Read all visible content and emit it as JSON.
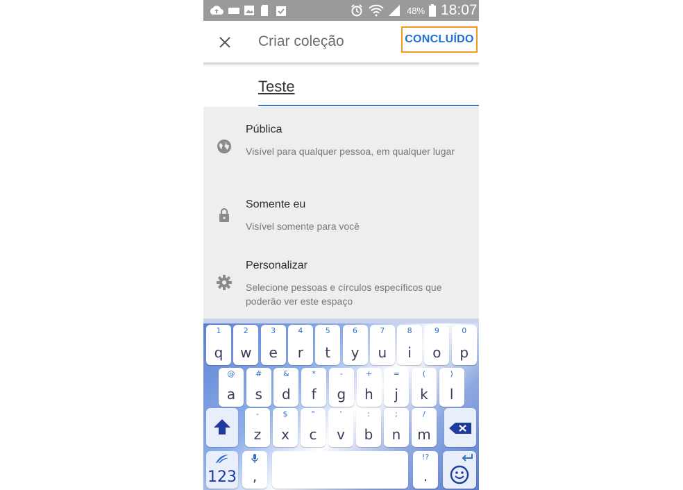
{
  "status_bar": {
    "battery": "48%",
    "time": "18:07"
  },
  "header": {
    "title": "Criar coleção",
    "done_label": "CONCLUÍDO"
  },
  "name_field": {
    "value": "Teste"
  },
  "options": [
    {
      "title": "Pública",
      "description": "Visível para qualquer pessoa, em qualquer lugar",
      "icon": "globe-icon"
    },
    {
      "title": "Somente eu",
      "description": "Visível somente para você",
      "icon": "lock-icon"
    },
    {
      "title": "Personalizar",
      "description": "Selecione pessoas e círculos específicos que poderão ver este espaço",
      "icon": "gear-icon"
    }
  ],
  "keyboard": {
    "row1": [
      {
        "k": "q",
        "s": "1"
      },
      {
        "k": "w",
        "s": "2"
      },
      {
        "k": "e",
        "s": "3"
      },
      {
        "k": "r",
        "s": "4"
      },
      {
        "k": "t",
        "s": "5"
      },
      {
        "k": "y",
        "s": "6"
      },
      {
        "k": "u",
        "s": "7"
      },
      {
        "k": "i",
        "s": "8"
      },
      {
        "k": "o",
        "s": "9"
      },
      {
        "k": "p",
        "s": "0"
      }
    ],
    "row2": [
      {
        "k": "a",
        "s": "@"
      },
      {
        "k": "s",
        "s": "#"
      },
      {
        "k": "d",
        "s": "&"
      },
      {
        "k": "f",
        "s": "*"
      },
      {
        "k": "g",
        "s": "-"
      },
      {
        "k": "h",
        "s": "+"
      },
      {
        "k": "j",
        "s": "="
      },
      {
        "k": "k",
        "s": "("
      },
      {
        "k": "l",
        "s": ")"
      }
    ],
    "row3": [
      {
        "k": "z",
        "s": "-"
      },
      {
        "k": "x",
        "s": "$"
      },
      {
        "k": "c",
        "s": "\""
      },
      {
        "k": "v",
        "s": "'"
      },
      {
        "k": "b",
        "s": ":"
      },
      {
        "k": "n",
        "s": ";"
      },
      {
        "k": "m",
        "s": "/"
      }
    ],
    "numbers_label": "123",
    "comma": ",",
    "period": ".",
    "period_sub": "!?"
  }
}
